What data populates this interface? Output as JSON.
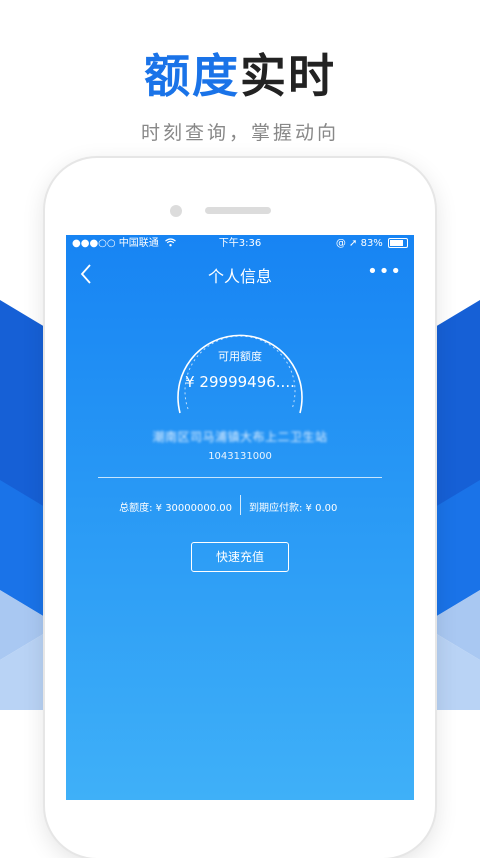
{
  "promo": {
    "title_accent": "额度",
    "title_rest": "实时",
    "subtitle": "时刻查询，掌握动向"
  },
  "status_bar": {
    "carrier": "●●●○○ 中国联通",
    "time": "下午3:36",
    "battery_text": "83%",
    "battery_level": 0.83
  },
  "nav": {
    "back_icon": "chevron-left-icon",
    "title": "个人信息",
    "more_icon": "more-icon",
    "more_glyph": "•••"
  },
  "balance": {
    "available_label": "可用额度",
    "available_amount": "¥ 29999496...."
  },
  "location": {
    "name": "潮南区司马浦镇大布上二卫生站",
    "account_no": "1043131000"
  },
  "summary": {
    "total_label": "总额度: ¥ 30000000.00",
    "due_label": "到期应付款: ¥ 0.00"
  },
  "actions": {
    "recharge_label": "快速充值"
  },
  "colors": {
    "accent": "#1a73e8",
    "screen_top": "#1784f3",
    "screen_bottom": "#3fb0f8"
  }
}
